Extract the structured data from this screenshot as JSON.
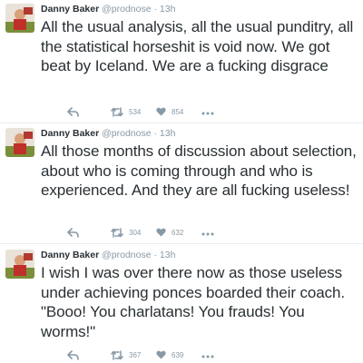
{
  "colors": {
    "text": "#292f33",
    "muted": "#8899a6",
    "divider": "#e6ecf0"
  },
  "tweets": [
    {
      "name": "Danny Baker",
      "handle": "@prodnose",
      "dot": "·",
      "time": "13h",
      "text": "All the usual analysis, all the usual punditry, all the statistical horseshit is void now. We got beat by Iceland. We are a fucking disgrace",
      "retweets": "534",
      "likes": "854",
      "icons": [
        "reply-icon",
        "retweet-icon",
        "like-icon",
        "more-icon"
      ]
    },
    {
      "name": "Danny Baker",
      "handle": "@prodnose",
      "dot": "·",
      "time": "13h",
      "text": "All those months of discussion about selection, about who is coming through and who is experienced. And they are all fucking useless!",
      "retweets": "304",
      "likes": "632",
      "icons": [
        "reply-icon",
        "retweet-icon",
        "like-icon",
        "more-icon"
      ]
    },
    {
      "name": "Danny Baker",
      "handle": "@prodnose",
      "dot": "·",
      "time": "13h",
      "text": "I wish I was over there now as those useless under achieving ponces boarded their coach. \"Booo! You charlatans! You frauds! You worms!\"",
      "retweets": "367",
      "likes": "639",
      "icons": [
        "reply-icon",
        "retweet-icon",
        "like-icon",
        "more-icon"
      ]
    }
  ]
}
